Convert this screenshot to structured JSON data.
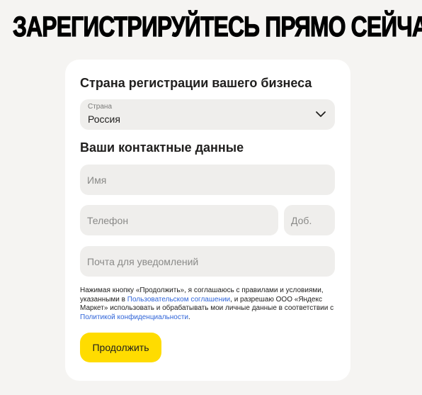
{
  "hero": {
    "title": "ЗАРЕГИСТРИРУЙТЕСЬ ПРЯМО СЕЙЧАС"
  },
  "form": {
    "country_section_title": "Страна регистрации вашего бизнеса",
    "country_select": {
      "label": "Страна",
      "value": "Россия",
      "icon": "chevron-down-icon"
    },
    "contacts_section_title": "Ваши контактные данные",
    "name_field": {
      "placeholder": "Имя"
    },
    "phone_field": {
      "placeholder": "Телефон"
    },
    "ext_field": {
      "placeholder": "Доб."
    },
    "email_field": {
      "placeholder": "Почта для уведомлений"
    },
    "consent": {
      "text_1": "Нажимая кнопку «Продолжить», я соглашаюсь с правилами и условиями, указанными в ",
      "link_1": "Пользовательском соглашении",
      "text_2": ", и разрешаю ООО «Яндекс Маркет» использовать и обрабатывать мои личные данные в соответствии с ",
      "link_2": "Политикой конфиденциальности",
      "text_3": "."
    },
    "submit_label": "Продолжить"
  },
  "colors": {
    "background": "#f5f4f2",
    "card": "#ffffff",
    "field": "#efeeec",
    "accent_button": "#ffdc00",
    "link": "#2f64d8"
  }
}
